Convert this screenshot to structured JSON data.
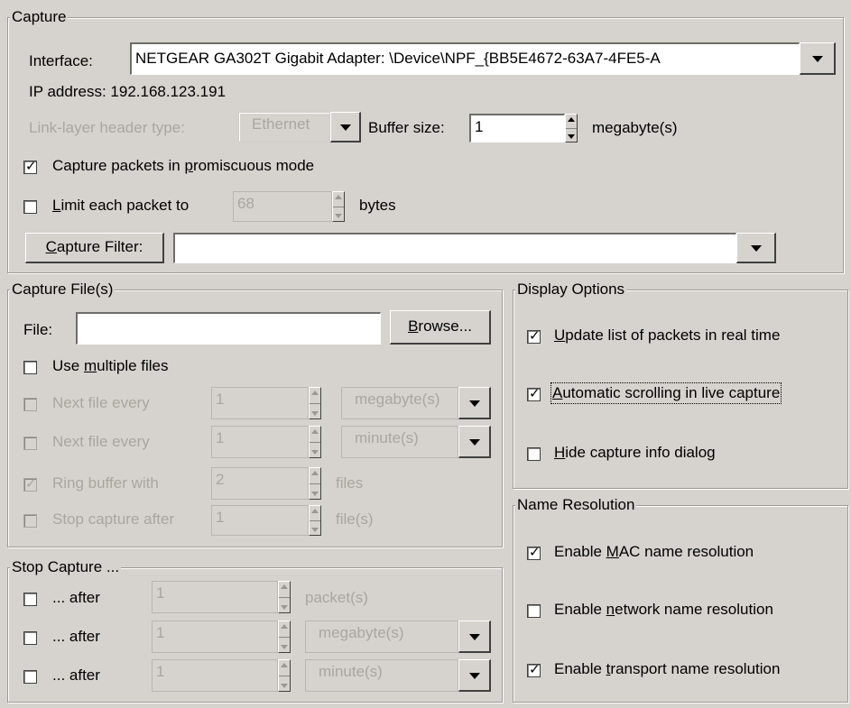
{
  "capture": {
    "title": "Capture",
    "interface_label": "Interface:",
    "interface_value": "NETGEAR GA302T Gigabit Adapter: \\Device\\NPF_{BB5E4672-63A7-4FE5-A",
    "ip_label": "IP address:",
    "ip_value": "192.168.123.191",
    "link_layer_label": "Link-layer header type:",
    "link_layer_value": "Ethernet",
    "buffer_label": "Buffer size:",
    "buffer_value": "1",
    "buffer_unit": "megabyte(s)",
    "promiscuous": {
      "pre": "Capture packets in ",
      "key": "p",
      "post": "romiscuous mode",
      "checked": true
    },
    "limit": {
      "pre": "",
      "key": "L",
      "post": "imit each packet to",
      "checked": false,
      "value": "68",
      "unit": "bytes"
    },
    "filter_button": {
      "pre": "",
      "key": "C",
      "post": "apture Filter:"
    },
    "filter_value": ""
  },
  "files": {
    "title": "Capture File(s)",
    "file_label": "File:",
    "file_value": "",
    "browse": {
      "pre": "",
      "key": "B",
      "post": "rowse..."
    },
    "multiple": {
      "pre": "Use ",
      "key": "m",
      "post": "ultiple files",
      "checked": false
    },
    "rows": [
      {
        "label": "Next file every",
        "value": "1",
        "unit": "megabyte(s)",
        "checked": false
      },
      {
        "label": "Next file every",
        "value": "1",
        "unit": "minute(s)",
        "checked": false
      },
      {
        "label": "Ring buffer with",
        "value": "2",
        "unit": "files",
        "checked": true
      },
      {
        "label": "Stop capture after",
        "value": "1",
        "unit": "file(s)",
        "checked": false
      }
    ]
  },
  "stop": {
    "title": "Stop Capture ...",
    "rows": [
      {
        "label": "... after",
        "value": "1",
        "unit": "packet(s)",
        "checked": false
      },
      {
        "label": "... after",
        "value": "1",
        "unit": "megabyte(s)",
        "checked": false
      },
      {
        "label": "... after",
        "value": "1",
        "unit": "minute(s)",
        "checked": false
      }
    ]
  },
  "display": {
    "title": "Display Options",
    "update": {
      "pre": "",
      "key": "U",
      "post": "pdate list of packets in real time",
      "checked": true
    },
    "autoscroll": {
      "pre": "",
      "key": "A",
      "post": "utomatic scrolling in live capture",
      "checked": true
    },
    "hide": {
      "pre": "",
      "key": "H",
      "post": "ide capture info dialog",
      "checked": false
    }
  },
  "names": {
    "title": "Name Resolution",
    "mac": {
      "pre": "Enable ",
      "key": "M",
      "post": "AC name resolution",
      "checked": true
    },
    "network": {
      "pre": "Enable ",
      "key": "n",
      "post": "etwork name resolution",
      "checked": false
    },
    "transport": {
      "pre": "Enable ",
      "key": "t",
      "post": "ransport name resolution",
      "checked": true
    }
  }
}
